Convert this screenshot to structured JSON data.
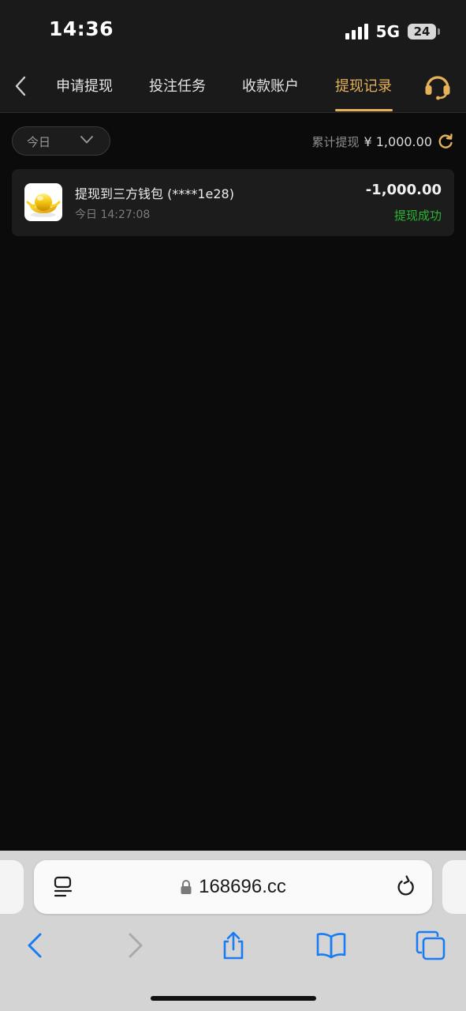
{
  "status_bar": {
    "time": "14:36",
    "network": "5G",
    "battery": "24"
  },
  "nav": {
    "tabs": [
      {
        "label": "申请提现",
        "active": false
      },
      {
        "label": "投注任务",
        "active": false
      },
      {
        "label": "收款账户",
        "active": false
      },
      {
        "label": "提现记录",
        "active": true
      }
    ]
  },
  "filter": {
    "date_selected": "今日",
    "total_label": "累计提现",
    "total_amount": "¥ 1,000.00"
  },
  "records": [
    {
      "title": "提现到三方钱包 (****1e28)",
      "time": "今日 14:27:08",
      "amount": "-1,000.00",
      "status": "提现成功"
    }
  ],
  "browser": {
    "url": "168696.cc"
  },
  "colors": {
    "accent": "#e5b25a",
    "success": "#29b532",
    "background": "#0b0b0b",
    "card": "#1c1c1c",
    "ios_blue": "#1a7cf2"
  }
}
